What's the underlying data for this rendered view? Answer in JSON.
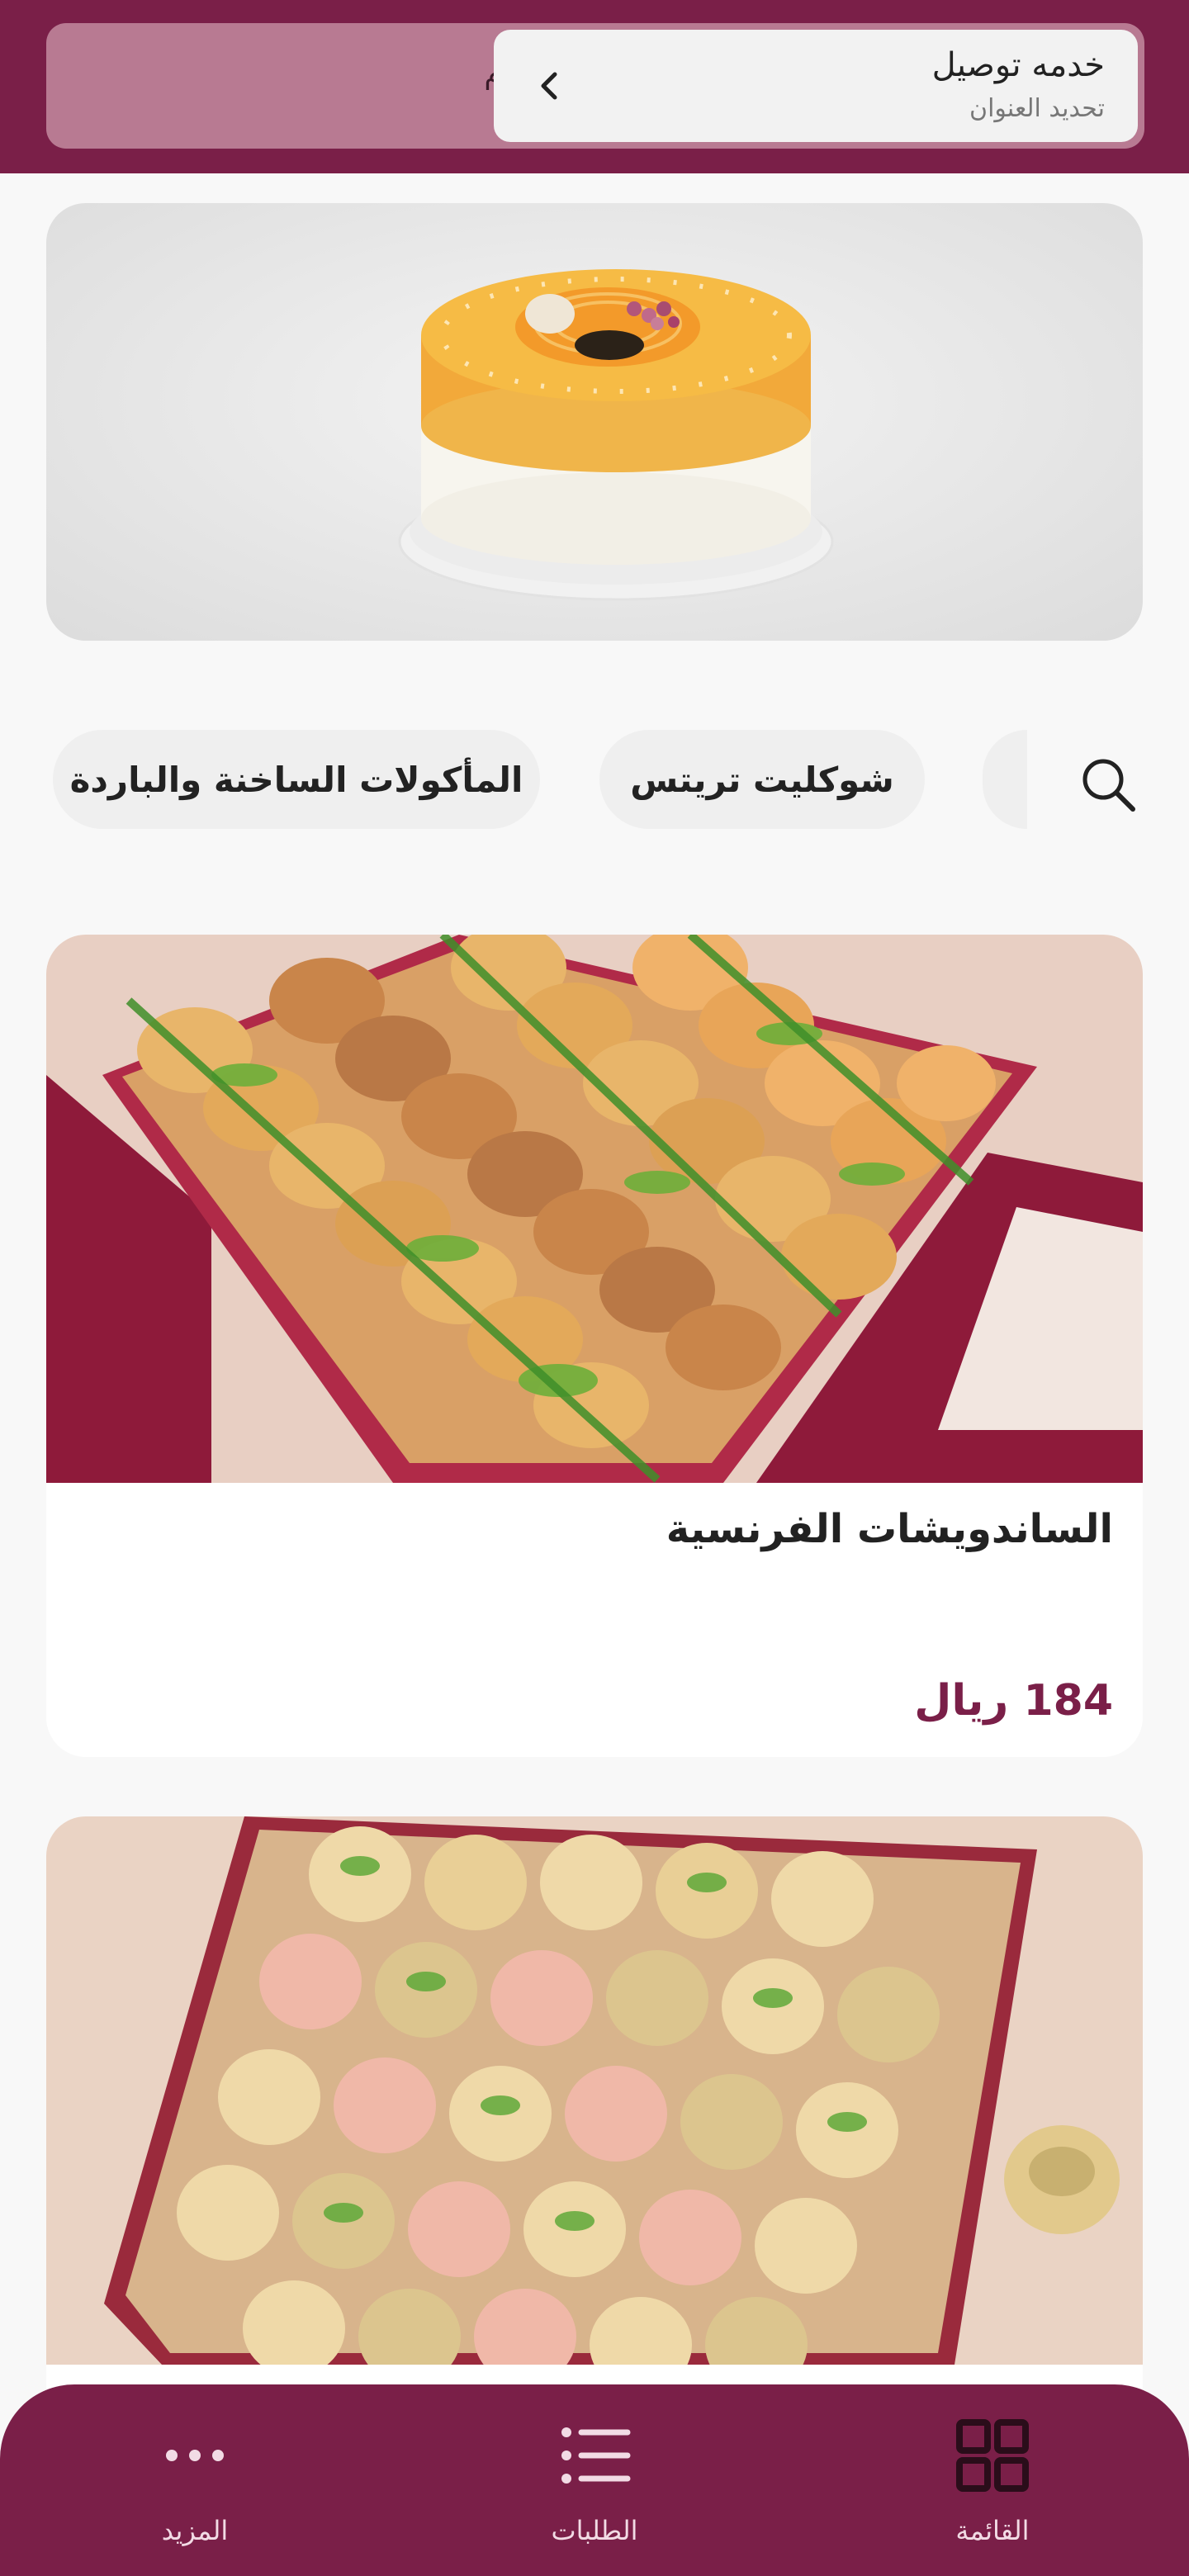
{
  "header": {
    "pickup_label": "استلام",
    "delivery_title": "خدمه توصيل",
    "delivery_subtitle": "تحديد العنوان"
  },
  "hero": {
    "image_icon": "cake-banner-image"
  },
  "categories": {
    "search_icon": "search-icon",
    "items": [
      {
        "label": "شوكليت تريتس"
      },
      {
        "label": "المأكولات الساخنة والباردة"
      }
    ]
  },
  "products": [
    {
      "name": "الساندويشات الفرنسية",
      "price": "184 ريال"
    },
    {
      "name": "",
      "price": ""
    }
  ],
  "bottom_nav": {
    "items": [
      {
        "label": "القائمة",
        "icon": "grid-icon"
      },
      {
        "label": "الطلبات",
        "icon": "list-icon"
      },
      {
        "label": "المزيد",
        "icon": "more-icon"
      }
    ]
  },
  "colors": {
    "brand": "#7a1f48",
    "brand_light": "#b87a92",
    "background": "#f8f8f8"
  }
}
